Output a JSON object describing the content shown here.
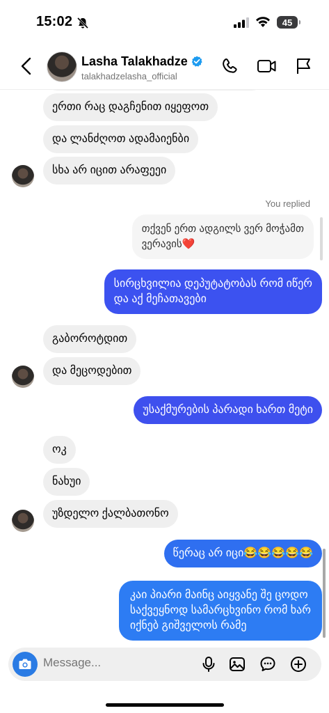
{
  "status": {
    "time": "15:02",
    "battery": "45"
  },
  "header": {
    "name": "Lasha Talakhadze",
    "username": "talakhadzelasha_official"
  },
  "messages": [
    {
      "text": "ერთი რაც დაგჩენით იყეფოთ"
    },
    {
      "text": "და ლანძღოთ ადამაიენბი"
    },
    {
      "text": "სხა არ იცით არაფეეი"
    },
    {
      "text": "You replied"
    },
    {
      "text": "თქვენ ერთ ადგილს ვერ მოჭამთ"
    },
    {
      "text": "ვერავის❤️"
    },
    {
      "text": "სირცხვილია დეპუტატობას რომ იწერ"
    },
    {
      "text": "და აქ მეჩათავები"
    },
    {
      "text": "გაბოროტდით"
    },
    {
      "text": "და მეცოდებით"
    },
    {
      "text": "უსაქმურების პარადი ხართ მეტი"
    },
    {
      "text": "ოკ"
    },
    {
      "text": "ნახუი"
    },
    {
      "text": "უზდელო ქალბათონო"
    },
    {
      "text": "წერაც არ იცი😂😂😂😂😂"
    },
    {
      "text": "კაი პიარი მაინც აიყვანე შე ცოდო"
    },
    {
      "text": "საქვეყნოდ სამარცხვინო რომ ხარ"
    },
    {
      "text": "იქნებ გიშველოს რამე"
    }
  ],
  "composer": {
    "placeholder": "Message..."
  },
  "colors": {
    "outgoing": "#3c52f0",
    "incoming": "#efefef",
    "verified": "#1d9bf0",
    "camera": "#2a7be4"
  },
  "icons": [
    "bell-slash-icon",
    "signal-icon",
    "wifi-icon",
    "battery-icon",
    "back-arrow-icon",
    "verified-badge-icon",
    "phone-icon",
    "video-camera-icon",
    "flag-icon",
    "camera-icon",
    "microphone-icon",
    "gallery-icon",
    "sticker-icon",
    "plus-icon"
  ]
}
